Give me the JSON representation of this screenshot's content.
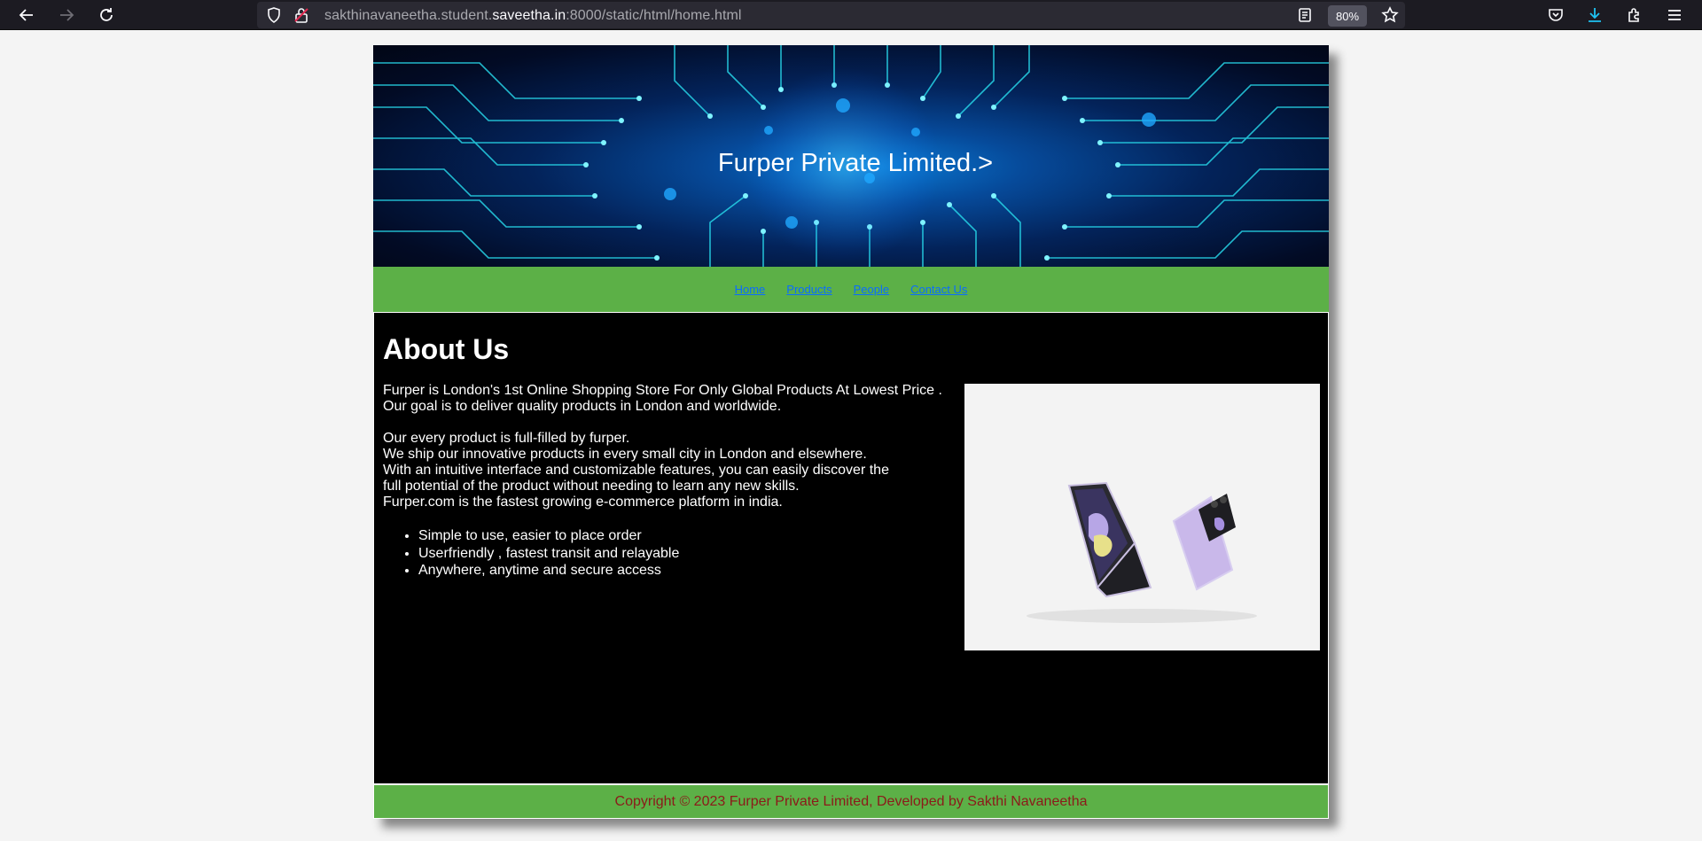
{
  "browser": {
    "url_prefix": "sakthinavaneetha.student.",
    "url_host": "saveetha.in",
    "url_suffix": ":8000/static/html/home.html",
    "zoom": "80%"
  },
  "header": {
    "title": "Furper Private Limited.>"
  },
  "nav": {
    "items": [
      {
        "label": "Home"
      },
      {
        "label": "Products"
      },
      {
        "label": "People"
      },
      {
        "label": "Contact Us"
      }
    ]
  },
  "about": {
    "title": "About Us",
    "paragraph1": [
      "Furper is London's 1st Online Shopping Store For Only Global Products At Lowest Price .",
      "Our goal is to deliver quality products in London and worldwide."
    ],
    "paragraph2": [
      "Our every product is full-filled by furper.",
      "We ship our innovative products in every small city in London and elsewhere.",
      "With an intuitive interface and customizable features, you can easily discover the",
      "full potential of the product without needing to learn any new skills.",
      "Furper.com is the fastest growing e-commerce platform in india."
    ],
    "bullets": [
      "Simple to use, easier to place order",
      "Userfriendly , fastest transit and relayable",
      "Anywhere, anytime and secure access"
    ]
  },
  "footer": {
    "copyright": "Copyright © 2023 Furper Private Limited, Developed by Sakthi Navaneetha"
  },
  "colors": {
    "nav_bg": "#5cb047",
    "footer_text": "#8b1a1a",
    "link": "#0a6cff",
    "content_bg": "#000000"
  }
}
